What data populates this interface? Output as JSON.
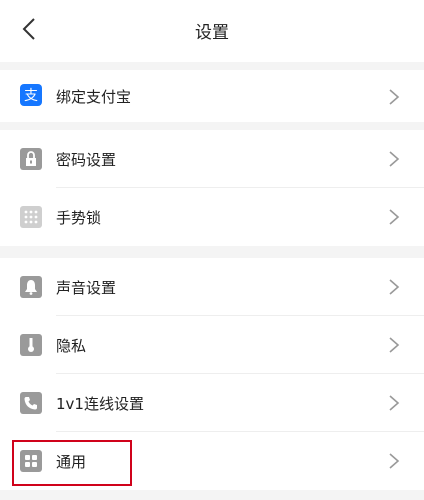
{
  "header": {
    "title": "设置",
    "back_icon": "chevron-left-icon"
  },
  "groups": [
    {
      "items": [
        {
          "label": "绑定支付宝",
          "icon": "alipay-icon"
        }
      ]
    },
    {
      "items": [
        {
          "label": "密码设置",
          "icon": "lock-icon"
        },
        {
          "label": "手势锁",
          "icon": "gesture-grid-icon"
        }
      ]
    },
    {
      "items": [
        {
          "label": "声音设置",
          "icon": "bell-icon"
        },
        {
          "label": "隐私",
          "icon": "privacy-icon"
        },
        {
          "label": "1v1连线设置",
          "icon": "call-icon"
        },
        {
          "label": "通用",
          "icon": "grid-icon"
        }
      ]
    }
  ],
  "colors": {
    "alipay": "#1677ff",
    "highlight": "#d0021b",
    "icon_gray": "#9a9a9a"
  }
}
